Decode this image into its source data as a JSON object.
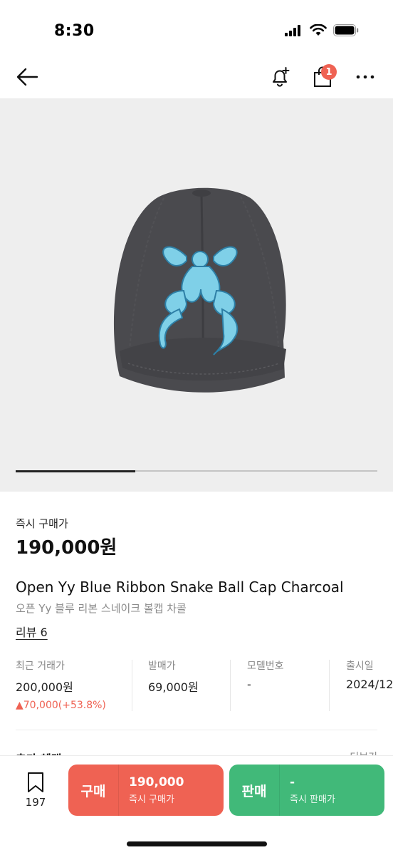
{
  "status_bar": {
    "time": "8:30"
  },
  "product": {
    "instant_buy_label": "즉시 구매가",
    "instant_buy_price": "190,000원",
    "title_en": "Open Yy Blue Ribbon Snake Ball Cap Charcoal",
    "title_ko": "오픈 Yy 블루 리본 스네이크 볼캡 차콜",
    "review_link": "리뷰 6",
    "image_progress": 0.33
  },
  "cart": {
    "badge": "1"
  },
  "stats": [
    {
      "label": "최근 거래가",
      "value": "200,000원",
      "change": "▲70,000(+53.8%)"
    },
    {
      "label": "발매가",
      "value": "69,000원"
    },
    {
      "label": "모델번호",
      "value": "-"
    },
    {
      "label": "출시일",
      "value": "2024/12"
    }
  ],
  "section_peek": {
    "left": "추가 혜택",
    "right": "더보기"
  },
  "bottom_bar": {
    "wish_count": "197",
    "buy": {
      "label": "구매",
      "price": "190,000",
      "sub": "즉시 구매가"
    },
    "sell": {
      "label": "판매",
      "price": "-",
      "sub": "즉시 판매가"
    }
  },
  "colors": {
    "buy": "#ef6253",
    "sell": "#41b979",
    "cap": "#4a4a4e",
    "ribbon": "#7fd0e8"
  }
}
